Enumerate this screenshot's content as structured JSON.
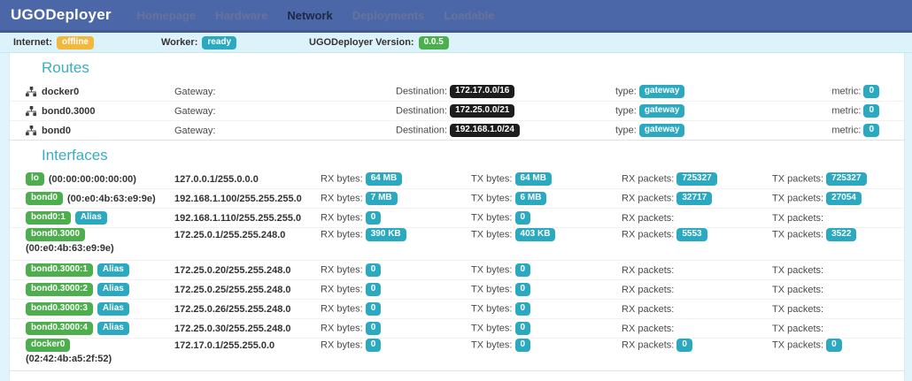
{
  "navbar": {
    "brand": "UGODeployer",
    "items": [
      {
        "label": "Homepage",
        "active": false
      },
      {
        "label": "Hardware",
        "active": false
      },
      {
        "label": "Network",
        "active": true
      },
      {
        "label": "Deployments",
        "active": false
      },
      {
        "label": "Loadable",
        "active": false
      }
    ]
  },
  "statusbar": {
    "internet_label": "Internet:",
    "internet_value": "offline",
    "worker_label": "Worker:",
    "worker_value": "ready",
    "version_label": "UGODeployer Version:",
    "version_value": "0.0.5"
  },
  "routes": {
    "title": "Routes",
    "labels": {
      "gateway": "Gateway:",
      "destination": "Destination:",
      "type": "type:",
      "metric": "metric:"
    },
    "rows": [
      {
        "name": "docker0",
        "destination": "172.17.0.0/16",
        "type": "gateway",
        "metric": "0"
      },
      {
        "name": "bond0.3000",
        "destination": "172.25.0.0/21",
        "type": "gateway",
        "metric": "0"
      },
      {
        "name": "bond0",
        "destination": "192.168.1.0/24",
        "type": "gateway",
        "metric": "0"
      }
    ]
  },
  "interfaces": {
    "title": "Interfaces",
    "labels": {
      "rx_bytes": "RX bytes:",
      "tx_bytes": "TX bytes:",
      "rx_packets": "RX packets:",
      "tx_packets": "TX packets:"
    },
    "rows": [
      {
        "name": "lo",
        "mac_inline": "(00:00:00:00:00:00)",
        "ip": "127.0.0.1/255.0.0.0",
        "rx_bytes": "64 MB",
        "tx_bytes": "64 MB",
        "rx_packets": "725327",
        "tx_packets": "725327"
      },
      {
        "name": "bond0",
        "mac_inline": "(00:e0:4b:63:e9:9e)",
        "ip": "192.168.1.100/255.255.255.0",
        "rx_bytes": "7 MB",
        "tx_bytes": "6 MB",
        "rx_packets": "32717",
        "tx_packets": "27054"
      },
      {
        "name": "bond0:1",
        "alias": "Alias",
        "ip": "192.168.1.110/255.255.255.0",
        "rx_bytes": "0",
        "tx_bytes": "0"
      },
      {
        "name": "bond0.3000",
        "mac_line": "(00:e0:4b:63:e9:9e)",
        "ip": "172.25.0.1/255.255.248.0",
        "rx_bytes": "390 KB",
        "tx_bytes": "403 KB",
        "rx_packets": "5553",
        "tx_packets": "3522"
      },
      {
        "name": "bond0.3000:1",
        "alias": "Alias",
        "ip": "172.25.0.20/255.255.248.0",
        "rx_bytes": "0",
        "tx_bytes": "0"
      },
      {
        "name": "bond0.3000:2",
        "alias": "Alias",
        "ip": "172.25.0.25/255.255.248.0",
        "rx_bytes": "0",
        "tx_bytes": "0"
      },
      {
        "name": "bond0.3000:3",
        "alias": "Alias",
        "ip": "172.25.0.26/255.255.248.0",
        "rx_bytes": "0",
        "tx_bytes": "0"
      },
      {
        "name": "bond0.3000:4",
        "alias": "Alias",
        "ip": "172.25.0.30/255.255.248.0",
        "rx_bytes": "0",
        "tx_bytes": "0"
      },
      {
        "name": "docker0",
        "mac_line": "(02:42:4b:a5:2f:52)",
        "ip": "172.17.0.1/255.255.0.0",
        "rx_bytes": "0",
        "tx_bytes": "0",
        "rx_packets": "0",
        "tx_packets": "0"
      }
    ]
  },
  "colors": {
    "navbar_bg": "#4c67a7",
    "statusbar_bg": "#ddf3fb",
    "badge_teal": "#2ba9c1",
    "badge_green": "#4cae4c",
    "badge_warning": "#f0b83c",
    "badge_dark": "#1d1d1d",
    "heading_teal": "#3aadc6"
  }
}
